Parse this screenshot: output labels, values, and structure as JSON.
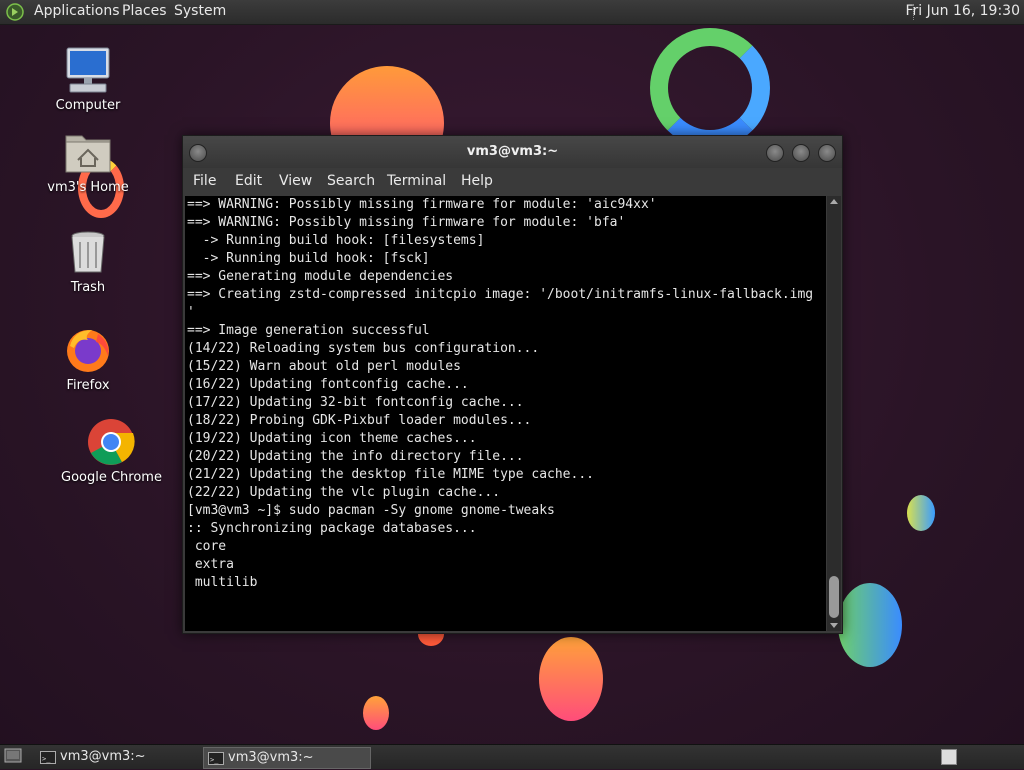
{
  "top_panel": {
    "menus": [
      "Applications",
      "Places",
      "System"
    ],
    "clock": "Fri Jun 16, 19:30"
  },
  "desktop_icons": [
    {
      "label": "Computer",
      "icon": "computer-icon"
    },
    {
      "label": "vm3's Home",
      "icon": "home-folder-icon"
    },
    {
      "label": "Trash",
      "icon": "trash-icon"
    },
    {
      "label": "Firefox",
      "icon": "firefox-icon"
    },
    {
      "label": "Google Chrome",
      "icon": "chrome-icon"
    }
  ],
  "terminal": {
    "title": "vm3@vm3:~",
    "menu": [
      "File",
      "Edit",
      "View",
      "Search",
      "Terminal",
      "Help"
    ],
    "lines": [
      "==> WARNING: Possibly missing firmware for module: 'aic94xx'",
      "==> WARNING: Possibly missing firmware for module: 'bfa'",
      "  -> Running build hook: [filesystems]",
      "  -> Running build hook: [fsck]",
      "==> Generating module dependencies",
      "==> Creating zstd-compressed initcpio image: '/boot/initramfs-linux-fallback.img",
      "'",
      "==> Image generation successful",
      "(14/22) Reloading system bus configuration...",
      "(15/22) Warn about old perl modules",
      "(16/22) Updating fontconfig cache...",
      "(17/22) Updating 32-bit fontconfig cache...",
      "(18/22) Probing GDK-Pixbuf loader modules...",
      "(19/22) Updating icon theme caches...",
      "(20/22) Updating the info directory file...",
      "(21/22) Updating the desktop file MIME type cache...",
      "(22/22) Updating the vlc plugin cache...",
      "[vm3@vm3 ~]$ sudo pacman -Sy gnome gnome-tweaks",
      ":: Synchronizing package databases...",
      " core",
      " extra",
      " multilib"
    ]
  },
  "taskbar": {
    "items": [
      "vm3@vm3:~",
      "vm3@vm3:~"
    ]
  },
  "colors": {
    "background": "#2a1426",
    "terminal_bg": "#000000",
    "terminal_fg": "#e6e6e6"
  }
}
